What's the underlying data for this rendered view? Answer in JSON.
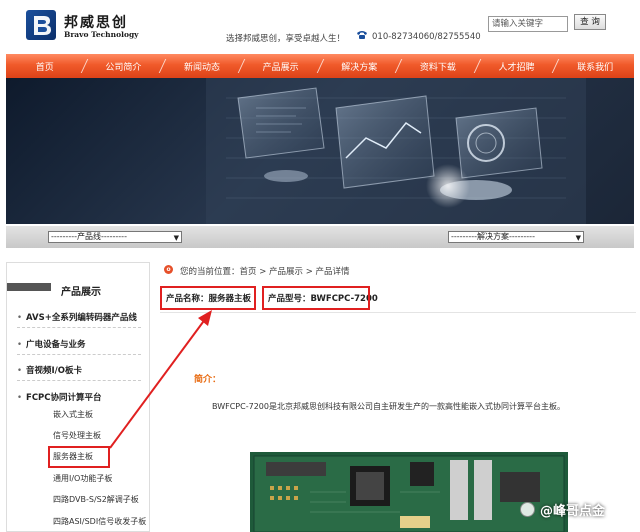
{
  "header": {
    "logo_cn": "邦威思创",
    "logo_en": "Bravo Technology",
    "slogan": "选择邦威思创，享受卓越人生！",
    "phone": "010-82734060/82755540",
    "search": {
      "placeholder": "请输入关键字",
      "button_label": "查 询"
    }
  },
  "nav": {
    "items": [
      {
        "label": "首页"
      },
      {
        "label": "公司简介"
      },
      {
        "label": "新闻动态"
      },
      {
        "label": "产品展示"
      },
      {
        "label": "解决方案"
      },
      {
        "label": "资料下载"
      },
      {
        "label": "人才招聘"
      },
      {
        "label": "联系我们"
      }
    ]
  },
  "filters": {
    "product_line": "---------产品线---------",
    "solution": "---------解决方案---------"
  },
  "sidebar": {
    "title": "产品展示",
    "categories": [
      {
        "label": "AVS+全系列编转码器产品线"
      },
      {
        "label": "广电设备与业务"
      },
      {
        "label": "音视频I/O板卡"
      },
      {
        "label": "FCPC协同计算平台"
      }
    ],
    "subitems": [
      {
        "label": "嵌入式主板"
      },
      {
        "label": "信号处理主板"
      },
      {
        "label": "服务器主板"
      },
      {
        "label": "通用I/O功能子板"
      },
      {
        "label": "四路DVB-S/S2解调子板"
      },
      {
        "label": "四路ASI/SDI信号收发子板"
      }
    ]
  },
  "breadcrumb": {
    "icon": "o",
    "text": "您的当前位置：首页 > 产品展示 > 产品详情"
  },
  "product": {
    "name_line": "产品名称：服务器主板",
    "model_line": "产品型号：BWFCPC-7200",
    "intro_label": "简介：",
    "intro_text": "BWFCPC-7200是北京邦威思创科技有限公司自主研发生产的一款高性能嵌入式协同计算平台主板。"
  },
  "watermark": "@峰哥点金",
  "colors": {
    "nav_orange": "#f05a2a",
    "highlight_red": "#e02020",
    "intro_orange": "#e86a10",
    "logo_blue": "#1b4f9c"
  }
}
